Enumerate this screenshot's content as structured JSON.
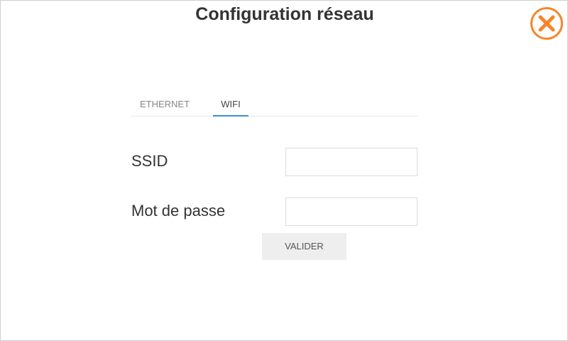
{
  "window": {
    "title": "Configuration réseau"
  },
  "close_button": {
    "icon": "close-icon",
    "accent_color": "#f7862b"
  },
  "tabs": [
    {
      "label": "ETHERNET",
      "active": false
    },
    {
      "label": "WIFI",
      "active": true
    }
  ],
  "tab_active_color": "#3b8fd6",
  "form": {
    "ssid": {
      "label": "SSID",
      "value": "",
      "placeholder": ""
    },
    "password": {
      "label": "Mot de passe",
      "value": "",
      "placeholder": ""
    },
    "submit_label": "VALIDER"
  }
}
